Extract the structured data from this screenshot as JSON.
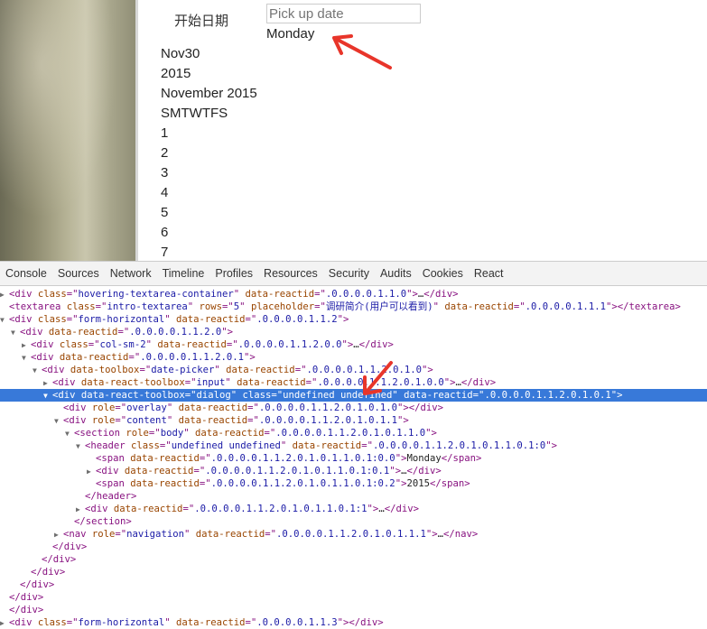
{
  "page": {
    "field_label": "开始日期",
    "date_placeholder": "Pick up date",
    "day_name": "Monday",
    "calendar_lines": [
      "Nov30",
      "2015",
      "November 2015",
      "SMTWTFS",
      "1",
      "2",
      "3",
      "4",
      "5",
      "6",
      "7"
    ]
  },
  "devtools": {
    "tabs": [
      "Console",
      "Sources",
      "Network",
      "Timeline",
      "Profiles",
      "Resources",
      "Security",
      "Audits",
      "Cookies",
      "React"
    ],
    "rows": [
      {
        "tri": "▶",
        "segs": [
          [
            "t",
            "<div "
          ],
          [
            "a",
            "class"
          ],
          [
            "t",
            "=\""
          ],
          [
            "v",
            "hovering-textarea-container"
          ],
          [
            "t",
            "\" "
          ],
          [
            "a",
            "data-reactid"
          ],
          [
            "t",
            "=\""
          ],
          [
            "v",
            ".0.0.0.0.1.1.0"
          ],
          [
            "t",
            "\">"
          ],
          [
            "x",
            "…"
          ],
          [
            "t",
            "</div>"
          ]
        ]
      },
      {
        "tri": "",
        "segs": [
          [
            "t",
            "<textarea "
          ],
          [
            "a",
            "class"
          ],
          [
            "t",
            "=\""
          ],
          [
            "v",
            "intro-textarea"
          ],
          [
            "t",
            "\" "
          ],
          [
            "a",
            "rows"
          ],
          [
            "t",
            "=\""
          ],
          [
            "v",
            "5"
          ],
          [
            "t",
            "\" "
          ],
          [
            "a",
            "placeholder"
          ],
          [
            "t",
            "=\""
          ],
          [
            "v",
            "调研简介(用户可以看到)"
          ],
          [
            "t",
            "\" "
          ],
          [
            "a",
            "data-reactid"
          ],
          [
            "t",
            "=\""
          ],
          [
            "v",
            ".0.0.0.0.1.1.1"
          ],
          [
            "t",
            "\"></textarea>"
          ]
        ]
      },
      {
        "tri": "▼",
        "segs": [
          [
            "t",
            "<div "
          ],
          [
            "a",
            "class"
          ],
          [
            "t",
            "=\""
          ],
          [
            "v",
            "form-horizontal"
          ],
          [
            "t",
            "\" "
          ],
          [
            "a",
            "data-reactid"
          ],
          [
            "t",
            "=\""
          ],
          [
            "v",
            ".0.0.0.0.1.1.2"
          ],
          [
            "t",
            "\">"
          ]
        ]
      },
      {
        "tri": "▼",
        "segs": [
          [
            "t",
            "<div "
          ],
          [
            "a",
            "data-reactid"
          ],
          [
            "t",
            "=\""
          ],
          [
            "v",
            ".0.0.0.0.1.1.2.0"
          ],
          [
            "t",
            "\">"
          ]
        ]
      },
      {
        "tri": "▶",
        "segs": [
          [
            "t",
            "<div "
          ],
          [
            "a",
            "class"
          ],
          [
            "t",
            "=\""
          ],
          [
            "v",
            "col-sm-2"
          ],
          [
            "t",
            "\" "
          ],
          [
            "a",
            "data-reactid"
          ],
          [
            "t",
            "=\""
          ],
          [
            "v",
            ".0.0.0.0.1.1.2.0.0"
          ],
          [
            "t",
            "\">"
          ],
          [
            "x",
            "…"
          ],
          [
            "t",
            "</div>"
          ]
        ]
      },
      {
        "tri": "▼",
        "segs": [
          [
            "t",
            "<div "
          ],
          [
            "a",
            "data-reactid"
          ],
          [
            "t",
            "=\""
          ],
          [
            "v",
            ".0.0.0.0.1.1.2.0.1"
          ],
          [
            "t",
            "\">"
          ]
        ]
      },
      {
        "tri": "▼",
        "segs": [
          [
            "t",
            "<div "
          ],
          [
            "a",
            "data-toolbox"
          ],
          [
            "t",
            "=\""
          ],
          [
            "v",
            "date-picker"
          ],
          [
            "t",
            "\" "
          ],
          [
            "a",
            "data-reactid"
          ],
          [
            "t",
            "=\""
          ],
          [
            "v",
            ".0.0.0.0.1.1.2.0.1.0"
          ],
          [
            "t",
            "\">"
          ]
        ]
      },
      {
        "tri": "▶",
        "segs": [
          [
            "t",
            "<div "
          ],
          [
            "a",
            "data-react-toolbox"
          ],
          [
            "t",
            "=\""
          ],
          [
            "v",
            "input"
          ],
          [
            "t",
            "\" "
          ],
          [
            "a",
            "data-reactid"
          ],
          [
            "t",
            "=\""
          ],
          [
            "v",
            ".0.0.0.0.1.1.2.0.1.0.0"
          ],
          [
            "t",
            "\">"
          ],
          [
            "x",
            "…"
          ],
          [
            "t",
            "</div>"
          ]
        ]
      },
      {
        "tri": "▼",
        "selected": true,
        "segs": [
          [
            "t",
            "<div "
          ],
          [
            "a",
            "data-react-toolbox"
          ],
          [
            "t",
            "=\""
          ],
          [
            "v",
            "dialog"
          ],
          [
            "t",
            "\" "
          ],
          [
            "a",
            "class"
          ],
          [
            "t",
            "=\""
          ],
          [
            "v",
            "undefined undefined"
          ],
          [
            "t",
            "\" "
          ],
          [
            "a",
            "data-reactid"
          ],
          [
            "t",
            "=\""
          ],
          [
            "v",
            ".0.0.0.0.1.1.2.0.1.0.1"
          ],
          [
            "t",
            "\">"
          ]
        ]
      },
      {
        "tri": "",
        "segs": [
          [
            "t",
            "<div "
          ],
          [
            "a",
            "role"
          ],
          [
            "t",
            "=\""
          ],
          [
            "v",
            "overlay"
          ],
          [
            "t",
            "\" "
          ],
          [
            "a",
            "data-reactid"
          ],
          [
            "t",
            "=\""
          ],
          [
            "v",
            ".0.0.0.0.1.1.2.0.1.0.1.0"
          ],
          [
            "t",
            "\"></div>"
          ]
        ]
      },
      {
        "tri": "▼",
        "segs": [
          [
            "t",
            "<div "
          ],
          [
            "a",
            "role"
          ],
          [
            "t",
            "=\""
          ],
          [
            "v",
            "content"
          ],
          [
            "t",
            "\" "
          ],
          [
            "a",
            "data-reactid"
          ],
          [
            "t",
            "=\""
          ],
          [
            "v",
            ".0.0.0.0.1.1.2.0.1.0.1.1"
          ],
          [
            "t",
            "\">"
          ]
        ]
      },
      {
        "tri": "▼",
        "segs": [
          [
            "t",
            "<section "
          ],
          [
            "a",
            "role"
          ],
          [
            "t",
            "=\""
          ],
          [
            "v",
            "body"
          ],
          [
            "t",
            "\" "
          ],
          [
            "a",
            "data-reactid"
          ],
          [
            "t",
            "=\""
          ],
          [
            "v",
            ".0.0.0.0.1.1.2.0.1.0.1.1.0"
          ],
          [
            "t",
            "\">"
          ]
        ]
      },
      {
        "tri": "▼",
        "segs": [
          [
            "t",
            "<header "
          ],
          [
            "a",
            "class"
          ],
          [
            "t",
            "=\""
          ],
          [
            "v",
            "undefined undefined"
          ],
          [
            "t",
            "\" "
          ],
          [
            "a",
            "data-reactid"
          ],
          [
            "t",
            "=\""
          ],
          [
            "v",
            ".0.0.0.0.1.1.2.0.1.0.1.1.0.1:0"
          ],
          [
            "t",
            "\">"
          ]
        ]
      },
      {
        "tri": "",
        "segs": [
          [
            "t",
            "<span "
          ],
          [
            "a",
            "data-reactid"
          ],
          [
            "t",
            "=\""
          ],
          [
            "v",
            ".0.0.0.0.1.1.2.0.1.0.1.1.0.1:0.0"
          ],
          [
            "t",
            "\">"
          ],
          [
            "x",
            "Monday"
          ],
          [
            "t",
            "</span>"
          ]
        ]
      },
      {
        "tri": "▶",
        "segs": [
          [
            "t",
            "<div "
          ],
          [
            "a",
            "data-reactid"
          ],
          [
            "t",
            "=\""
          ],
          [
            "v",
            ".0.0.0.0.1.1.2.0.1.0.1.1.0.1:0.1"
          ],
          [
            "t",
            "\">"
          ],
          [
            "x",
            "…"
          ],
          [
            "t",
            "</div>"
          ]
        ]
      },
      {
        "tri": "",
        "segs": [
          [
            "t",
            "<span "
          ],
          [
            "a",
            "data-reactid"
          ],
          [
            "t",
            "=\""
          ],
          [
            "v",
            ".0.0.0.0.1.1.2.0.1.0.1.1.0.1:0.2"
          ],
          [
            "t",
            "\">"
          ],
          [
            "x",
            "2015"
          ],
          [
            "t",
            "</span>"
          ]
        ]
      },
      {
        "tri": "",
        "segs": [
          [
            "t",
            "</header>"
          ]
        ]
      },
      {
        "tri": "▶",
        "segs": [
          [
            "t",
            "<div "
          ],
          [
            "a",
            "data-reactid"
          ],
          [
            "t",
            "=\""
          ],
          [
            "v",
            ".0.0.0.0.1.1.2.0.1.0.1.1.0.1:1"
          ],
          [
            "t",
            "\">"
          ],
          [
            "x",
            "…"
          ],
          [
            "t",
            "</div>"
          ]
        ]
      },
      {
        "tri": "",
        "segs": [
          [
            "t",
            "</section>"
          ]
        ]
      },
      {
        "tri": "▶",
        "segs": [
          [
            "t",
            "<nav "
          ],
          [
            "a",
            "role"
          ],
          [
            "t",
            "=\""
          ],
          [
            "v",
            "navigation"
          ],
          [
            "t",
            "\" "
          ],
          [
            "a",
            "data-reactid"
          ],
          [
            "t",
            "=\""
          ],
          [
            "v",
            ".0.0.0.0.1.1.2.0.1.0.1.1.1"
          ],
          [
            "t",
            "\">"
          ],
          [
            "x",
            "…"
          ],
          [
            "t",
            "</nav>"
          ]
        ]
      },
      {
        "tri": "",
        "segs": [
          [
            "t",
            "</div>"
          ]
        ]
      },
      {
        "tri": "",
        "segs": [
          [
            "t",
            "</div>"
          ]
        ]
      },
      {
        "tri": "",
        "segs": [
          [
            "t",
            "</div>"
          ]
        ]
      },
      {
        "tri": "",
        "segs": [
          [
            "t",
            "</div>"
          ]
        ]
      },
      {
        "tri": "",
        "segs": [
          [
            "t",
            "</div>"
          ]
        ]
      },
      {
        "tri": "",
        "segs": [
          [
            "t",
            "</div>"
          ]
        ]
      },
      {
        "tri": "▶",
        "segs": [
          [
            "t",
            "<div "
          ],
          [
            "a",
            "class"
          ],
          [
            "t",
            "=\""
          ],
          [
            "v",
            "form-horizontal"
          ],
          [
            "t",
            "\" "
          ],
          [
            "a",
            "data-reactid"
          ],
          [
            "t",
            "=\""
          ],
          [
            "v",
            ".0.0.0.0.1.1.3"
          ],
          [
            "t",
            "\"></div>"
          ]
        ]
      }
    ]
  },
  "colors": {
    "selection": "#3879d9",
    "annotation_arrow": "#e8352a",
    "tag": "#881280",
    "attr_name": "#994500",
    "attr_value": "#1a1aa6"
  },
  "icons": {
    "annotation": "red-arrow-icon",
    "expand": "triangle-right-icon",
    "collapse": "triangle-down-icon"
  }
}
